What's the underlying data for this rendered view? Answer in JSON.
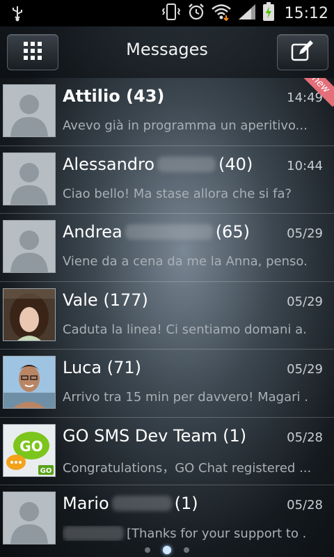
{
  "status_bar": {
    "time": "15:12",
    "icons": [
      "usb-icon",
      "vibrate-icon",
      "alarm-icon",
      "wifi-icon",
      "signal-icon",
      "battery-charging-icon"
    ]
  },
  "header": {
    "title": "Messages",
    "left_button_icon": "grid-menu-icon",
    "right_button_icon": "compose-icon"
  },
  "threads": [
    {
      "name": "Attilio",
      "count": "(43)",
      "time": "14:49",
      "preview": "Avevo già in programma un aperitivo...",
      "new_badge": "new",
      "avatar": "default",
      "name_blurred": false
    },
    {
      "name": "Alessandro",
      "count": "(40)",
      "time": "10:44",
      "preview": "Ciao bello! Ma stase allora che si fa?",
      "avatar": "default",
      "name_blurred": true
    },
    {
      "name": "Andrea",
      "count": "(65)",
      "time": "05/29",
      "preview": "Viene da a cena da me la Anna, penso.",
      "avatar": "default",
      "name_blurred": true
    },
    {
      "name": "Vale",
      "count": "(177)",
      "time": "05/29",
      "preview": "Caduta la linea! Ci sentiamo domani a.",
      "avatar": "photo-woman",
      "name_blurred": false
    },
    {
      "name": "Luca",
      "count": "(71)",
      "time": "05/29",
      "preview": "Arrivo tra 15 min per davvero! Magari .",
      "avatar": "photo-man",
      "name_blurred": false
    },
    {
      "name": "GO SMS Dev Team",
      "count": "(1)",
      "time": "05/28",
      "preview": "Congratulations，GO Chat registered ...",
      "avatar": "go-sms-logo",
      "name_blurred": false
    },
    {
      "name": "Mario",
      "count": "(1)",
      "time": "05/28",
      "preview": "[Thanks for your support to .",
      "avatar": "default",
      "name_blurred": true
    }
  ],
  "pager": {
    "pages": 3,
    "active": 2
  }
}
